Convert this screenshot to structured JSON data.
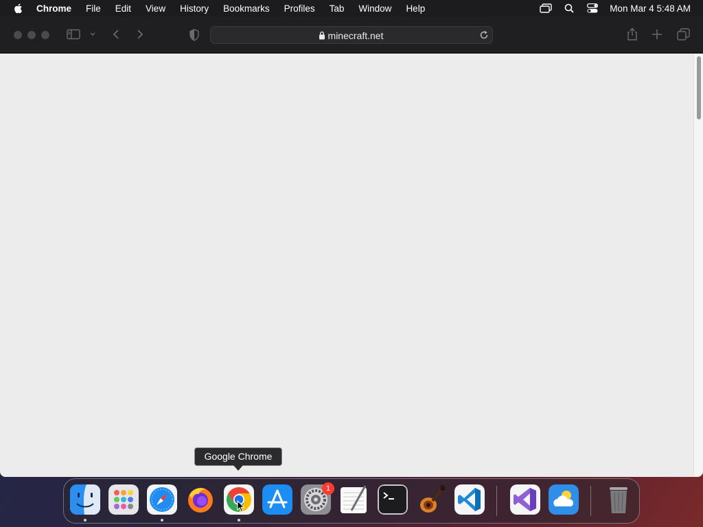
{
  "menubar": {
    "app_name": "Chrome",
    "items": [
      "File",
      "Edit",
      "View",
      "History",
      "Bookmarks",
      "Profiles",
      "Tab",
      "Window",
      "Help"
    ],
    "clock": "Mon Mar 4  5:48 AM"
  },
  "browser": {
    "url": "minecraft.net"
  },
  "tooltip": {
    "label": "Google Chrome"
  },
  "dock": {
    "apps": [
      "Finder",
      "Launchpad",
      "Safari",
      "Firefox",
      "Google Chrome",
      "App Store",
      "System Settings",
      "TextEdit",
      "Terminal",
      "GarageBand",
      "Visual Studio Code",
      "Visual Studio",
      "Weather",
      "Trash"
    ],
    "settings_badge": "1"
  },
  "colors": {
    "toolbar": "#1f1f21",
    "content": "#ececec",
    "badge": "#ff3b30"
  }
}
